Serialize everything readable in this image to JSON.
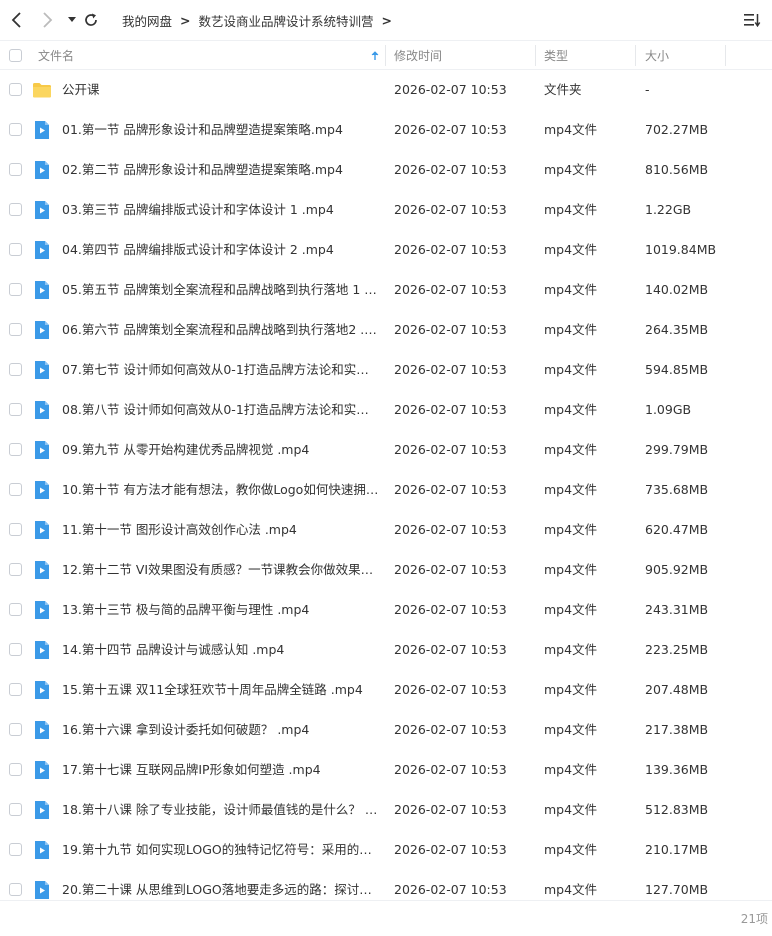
{
  "breadcrumb": {
    "root": "我的网盘",
    "current": "数艺设商业品牌设计系统特训营"
  },
  "columns": {
    "name": "文件名",
    "modified": "修改时间",
    "type": "类型",
    "size": "大小"
  },
  "colors": {
    "folder": "#f7c948",
    "video": "#3b9ae8",
    "sort_arrow": "#3b9ae8"
  },
  "files": [
    {
      "name": "公开课",
      "modified": "2026-02-07 10:53",
      "type": "文件夹",
      "size": "-",
      "icon": "folder-icon"
    },
    {
      "name": "01.第一节 品牌形象设计和品牌塑造提案策略.mp4",
      "modified": "2026-02-07 10:53",
      "type": "mp4文件",
      "size": "702.27MB",
      "icon": "video-file-icon"
    },
    {
      "name": "02.第二节 品牌形象设计和品牌塑造提案策略.mp4",
      "modified": "2026-02-07 10:53",
      "type": "mp4文件",
      "size": "810.56MB",
      "icon": "video-file-icon"
    },
    {
      "name": "03.第三节 品牌编排版式设计和字体设计 1 .mp4",
      "modified": "2026-02-07 10:53",
      "type": "mp4文件",
      "size": "1.22GB",
      "icon": "video-file-icon"
    },
    {
      "name": "04.第四节 品牌编排版式设计和字体设计 2 .mp4",
      "modified": "2026-02-07 10:53",
      "type": "mp4文件",
      "size": "1019.84MB",
      "icon": "video-file-icon"
    },
    {
      "name": "05.第五节 品牌策划全案流程和品牌战略到执行落地 1 .m...",
      "modified": "2026-02-07 10:53",
      "type": "mp4文件",
      "size": "140.02MB",
      "icon": "video-file-icon"
    },
    {
      "name": "06.第六节 品牌策划全案流程和品牌战略到执行落地2 .mp4",
      "modified": "2026-02-07 10:53",
      "type": "mp4文件",
      "size": "264.35MB",
      "icon": "video-file-icon"
    },
    {
      "name": "07.第七节 设计师如何高效从0-1打造品牌方法论和实战演...",
      "modified": "2026-02-07 10:53",
      "type": "mp4文件",
      "size": "594.85MB",
      "icon": "video-file-icon"
    },
    {
      "name": "08.第八节 设计师如何高效从0-1打造品牌方法论和实战演...",
      "modified": "2026-02-07 10:53",
      "type": "mp4文件",
      "size": "1.09GB",
      "icon": "video-file-icon"
    },
    {
      "name": "09.第九节 从零开始构建优秀品牌视觉 .mp4",
      "modified": "2026-02-07 10:53",
      "type": "mp4文件",
      "size": "299.79MB",
      "icon": "video-file-icon"
    },
    {
      "name": "10.第十节 有方法才能有想法，教你做Logo如何快速拥有...",
      "modified": "2026-02-07 10:53",
      "type": "mp4文件",
      "size": "735.68MB",
      "icon": "video-file-icon"
    },
    {
      "name": "11.第十一节 图形设计高效创作心法 .mp4",
      "modified": "2026-02-07 10:53",
      "type": "mp4文件",
      "size": "620.47MB",
      "icon": "video-file-icon"
    },
    {
      "name": "12.第十二节 VI效果图没有质感？一节课教会你做效果图...",
      "modified": "2026-02-07 10:53",
      "type": "mp4文件",
      "size": "905.92MB",
      "icon": "video-file-icon"
    },
    {
      "name": "13.第十三节 极与简的品牌平衡与理性 .mp4",
      "modified": "2026-02-07 10:53",
      "type": "mp4文件",
      "size": "243.31MB",
      "icon": "video-file-icon"
    },
    {
      "name": "14.第十四节 品牌设计与诚感认知 .mp4",
      "modified": "2026-02-07 10:53",
      "type": "mp4文件",
      "size": "223.25MB",
      "icon": "video-file-icon"
    },
    {
      "name": "15.第十五课 双11全球狂欢节十周年品牌全链路 .mp4",
      "modified": "2026-02-07 10:53",
      "type": "mp4文件",
      "size": "207.48MB",
      "icon": "video-file-icon"
    },
    {
      "name": "16.第十六课 拿到设计委托如何破题？ .mp4",
      "modified": "2026-02-07 10:53",
      "type": "mp4文件",
      "size": "217.38MB",
      "icon": "video-file-icon"
    },
    {
      "name": "17.第十七课 互联网品牌IP形象如何塑造 .mp4",
      "modified": "2026-02-07 10:53",
      "type": "mp4文件",
      "size": "139.36MB",
      "icon": "video-file-icon"
    },
    {
      "name": "18.第十八课 除了专业技能，设计师最值钱的是什么？ .m...",
      "modified": "2026-02-07 10:53",
      "type": "mp4文件",
      "size": "512.83MB",
      "icon": "video-file-icon"
    },
    {
      "name": "19.第十九节 如何实现LOGO的独特记忆符号：采用的独...",
      "modified": "2026-02-07 10:53",
      "type": "mp4文件",
      "size": "210.17MB",
      "icon": "video-file-icon"
    },
    {
      "name": "20.第二十课 从思维到LOGO落地要走多远的路：探讨在...",
      "modified": "2026-02-07 10:53",
      "type": "mp4文件",
      "size": "127.70MB",
      "icon": "video-file-icon"
    }
  ],
  "footer": {
    "count": "21项"
  }
}
